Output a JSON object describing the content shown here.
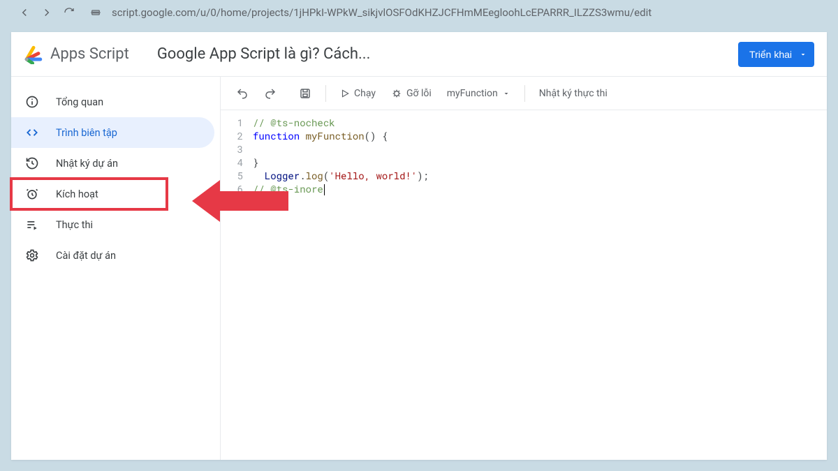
{
  "browser": {
    "url": "script.google.com/u/0/home/projects/1jHPkI-WPkW_sikjvlOSFOdKHZJCFHmMEegloohLcEPARRR_ILZZS3wmu/edit"
  },
  "header": {
    "product": "Apps Script",
    "project_title": "Google App Script là gì? Cách...",
    "deploy_label": "Triển khai"
  },
  "sidebar": {
    "items": [
      {
        "icon": "info-icon",
        "label": "Tổng quan"
      },
      {
        "icon": "code-icon",
        "label": "Trình biên tập"
      },
      {
        "icon": "history-icon",
        "label": "Nhật ký dự án"
      },
      {
        "icon": "alarm-icon",
        "label": "Kích hoạt"
      },
      {
        "icon": "playlist-icon",
        "label": "Thực thi"
      },
      {
        "icon": "gear-icon",
        "label": "Cài đặt dự án"
      }
    ]
  },
  "toolbar": {
    "run_label": "Chạy",
    "debug_label": "Gỡ lỗi",
    "function_selected": "myFunction",
    "log_label": "Nhật ký thực thi"
  },
  "code": {
    "lines": [
      {
        "n": "1",
        "seg": [
          {
            "t": "// @ts-nocheck",
            "c": "tok-comment"
          }
        ]
      },
      {
        "n": "2",
        "seg": [
          {
            "t": "function ",
            "c": "tok-keyword"
          },
          {
            "t": "myFunction",
            "c": "tok-func"
          },
          {
            "t": "() {",
            "c": "tok-punc"
          }
        ]
      },
      {
        "n": "3",
        "seg": [
          {
            "t": "  ",
            "c": ""
          }
        ]
      },
      {
        "n": "4",
        "seg": [
          {
            "t": "}",
            "c": "tok-punc"
          }
        ]
      },
      {
        "n": "5",
        "seg": [
          {
            "t": "  Logger",
            "c": "tok-ident"
          },
          {
            "t": ".",
            "c": "tok-punc"
          },
          {
            "t": "log",
            "c": "tok-func"
          },
          {
            "t": "(",
            "c": "tok-punc"
          },
          {
            "t": "'Hello, world!'",
            "c": "tok-string"
          },
          {
            "t": ");",
            "c": "tok-punc"
          }
        ]
      },
      {
        "n": "6",
        "seg": [
          {
            "t": "// @ts-inore",
            "c": "tok-comment"
          }
        ]
      }
    ],
    "highlight_line_index": 5
  }
}
